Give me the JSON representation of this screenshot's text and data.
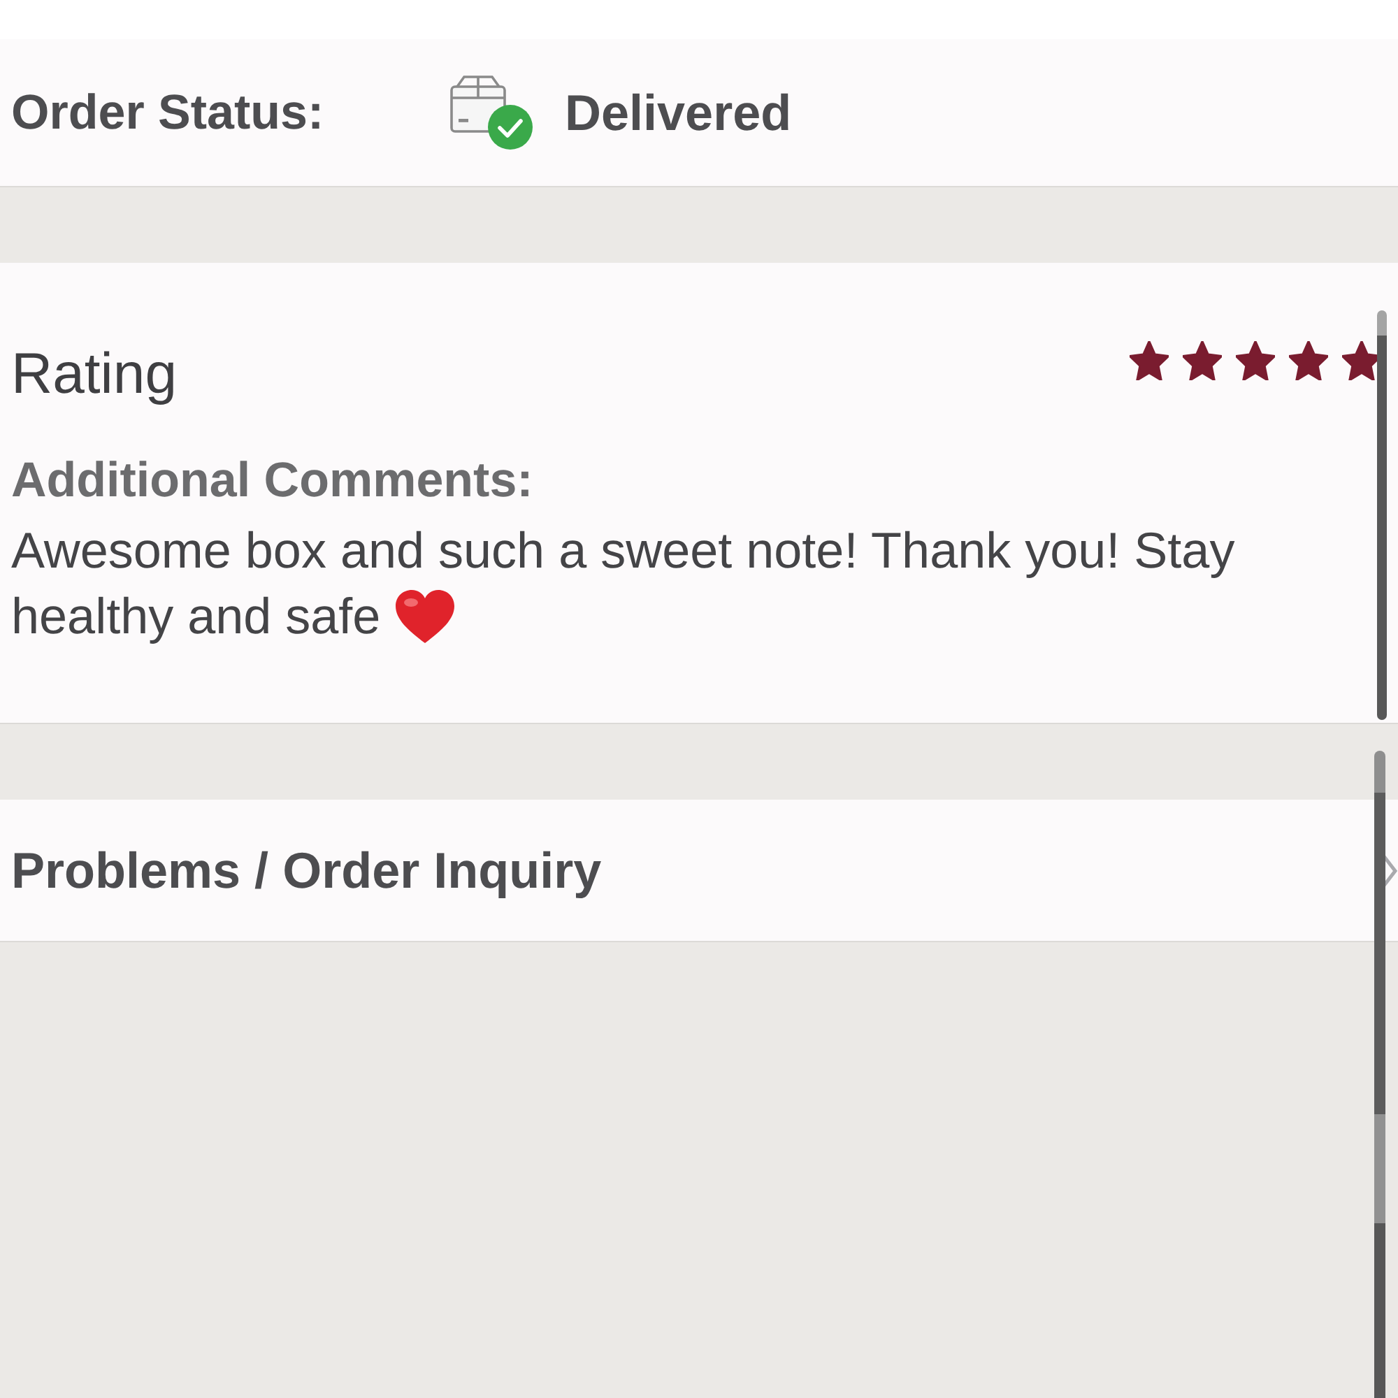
{
  "order_status": {
    "label": "Order Status:",
    "value": "Delivered"
  },
  "rating": {
    "label": "Rating",
    "stars": 5,
    "comments_label": "Additional Comments:",
    "comments": "Awesome box and such a sweet note! Thank you! Stay healthy and safe"
  },
  "links": [
    {
      "label": "Problems / Order Inquiry"
    }
  ]
}
